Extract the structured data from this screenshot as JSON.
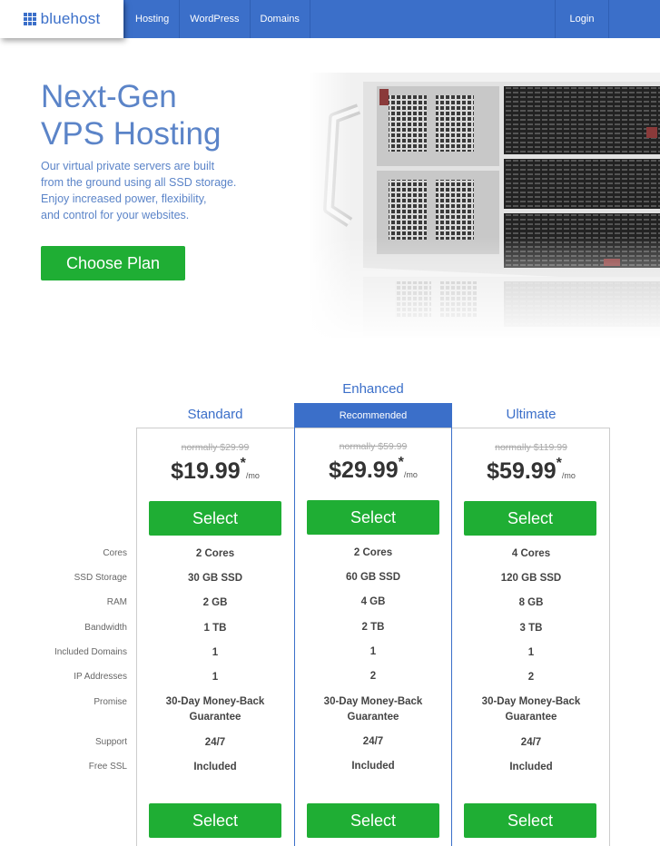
{
  "header": {
    "logo_text": "bluehost",
    "nav": [
      "Hosting",
      "WordPress",
      "Domains"
    ],
    "login_label": "Login"
  },
  "hero": {
    "title_line1": "Next-Gen",
    "title_line2": "VPS Hosting",
    "desc_lines": [
      "Our virtual private servers are built",
      "from the ground using all SSD storage.",
      "Enjoy increased power, flexibility,",
      "and control for your websites."
    ],
    "cta_label": "Choose Plan"
  },
  "pricing": {
    "recommended_label": "Recommended",
    "feature_labels": [
      "Cores",
      "SSD Storage",
      "RAM",
      "Bandwidth",
      "Included Domains",
      "IP Addresses",
      "Promise",
      "Support",
      "Free SSL"
    ],
    "plans": [
      {
        "name": "Standard",
        "old_price": "normally $29.99",
        "price": "$19.99",
        "asterisk": "*",
        "per": "/mo",
        "select_label": "Select",
        "features": [
          "2 Cores",
          "30 GB SSD",
          "2 GB",
          "1 TB",
          "1",
          "1",
          "30-Day Money-Back Guarantee",
          "24/7",
          "Included"
        ]
      },
      {
        "name": "Enhanced",
        "old_price": "normally $59.99",
        "price": "$29.99",
        "asterisk": "*",
        "per": "/mo",
        "select_label": "Select",
        "features": [
          "2 Cores",
          "60 GB SSD",
          "4 GB",
          "2 TB",
          "1",
          "2",
          "30-Day Money-Back Guarantee",
          "24/7",
          "Included"
        ]
      },
      {
        "name": "Ultimate",
        "old_price": "normally $119.99",
        "price": "$59.99",
        "asterisk": "*",
        "per": "/mo",
        "select_label": "Select",
        "features": [
          "4 Cores",
          "120 GB SSD",
          "8 GB",
          "3 TB",
          "1",
          "2",
          "30-Day Money-Back Guarantee",
          "24/7",
          "Included"
        ]
      }
    ]
  },
  "colors": {
    "brand_blue": "#3b6fc9",
    "button_green": "#1fae34",
    "hero_text": "#5b84c8"
  },
  "icons": [
    "grid-logo-icon",
    "server-image"
  ]
}
